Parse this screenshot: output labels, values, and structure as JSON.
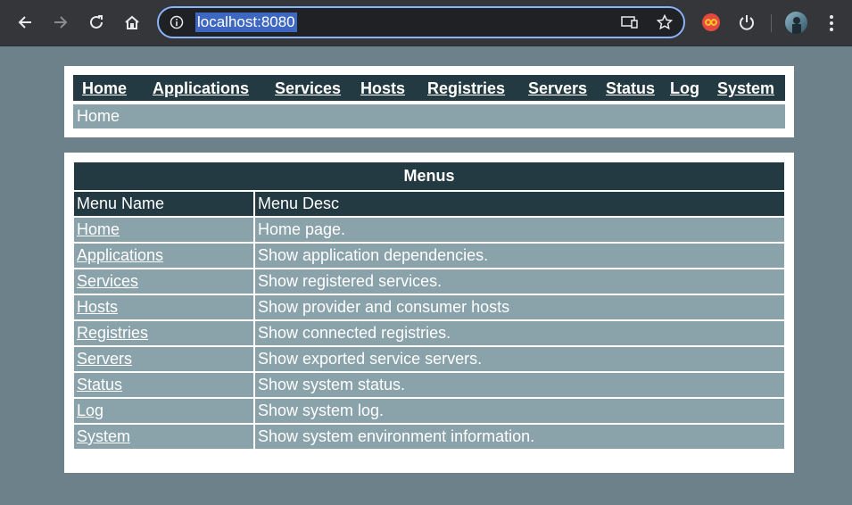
{
  "browser": {
    "url": "localhost:8080"
  },
  "nav": {
    "items": [
      "Home",
      "Applications",
      "Services",
      "Hosts",
      "Registries",
      "Servers",
      "Status",
      "Log",
      "System"
    ]
  },
  "breadcrumb": "Home",
  "menus": {
    "title": "Menus",
    "columns": [
      "Menu Name",
      "Menu Desc"
    ],
    "rows": [
      {
        "name": "Home",
        "desc": "Home page."
      },
      {
        "name": "Applications",
        "desc": "Show application dependencies."
      },
      {
        "name": "Services",
        "desc": "Show registered services."
      },
      {
        "name": "Hosts",
        "desc": "Show provider and consumer hosts"
      },
      {
        "name": "Registries",
        "desc": "Show connected registries."
      },
      {
        "name": "Servers",
        "desc": "Show exported service servers."
      },
      {
        "name": "Status",
        "desc": "Show system status."
      },
      {
        "name": "Log",
        "desc": "Show system log."
      },
      {
        "name": "System",
        "desc": "Show system environment information."
      }
    ]
  },
  "colors": {
    "page_bg": "#6c818a",
    "header_bg": "#233a43",
    "row_bg": "#8aa2aa"
  }
}
